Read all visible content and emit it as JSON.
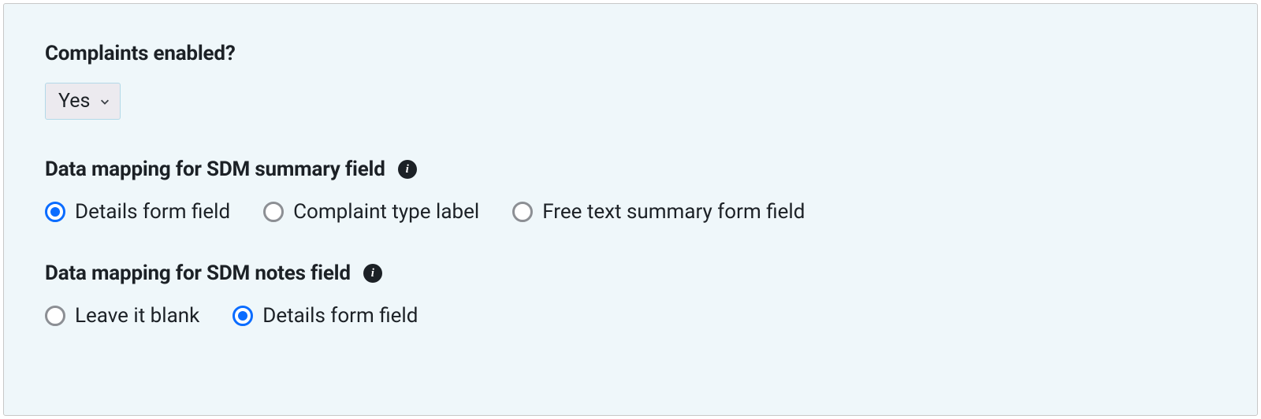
{
  "sections": {
    "complaints": {
      "label": "Complaints enabled?",
      "select_value": "Yes"
    },
    "summary_mapping": {
      "label": "Data mapping for SDM summary field",
      "options": [
        {
          "label": "Details form field",
          "checked": true
        },
        {
          "label": "Complaint type label",
          "checked": false
        },
        {
          "label": "Free text summary form field",
          "checked": false
        }
      ]
    },
    "notes_mapping": {
      "label": "Data mapping for SDM notes field",
      "options": [
        {
          "label": "Leave it blank",
          "checked": false
        },
        {
          "label": "Details form field",
          "checked": true
        }
      ]
    }
  }
}
